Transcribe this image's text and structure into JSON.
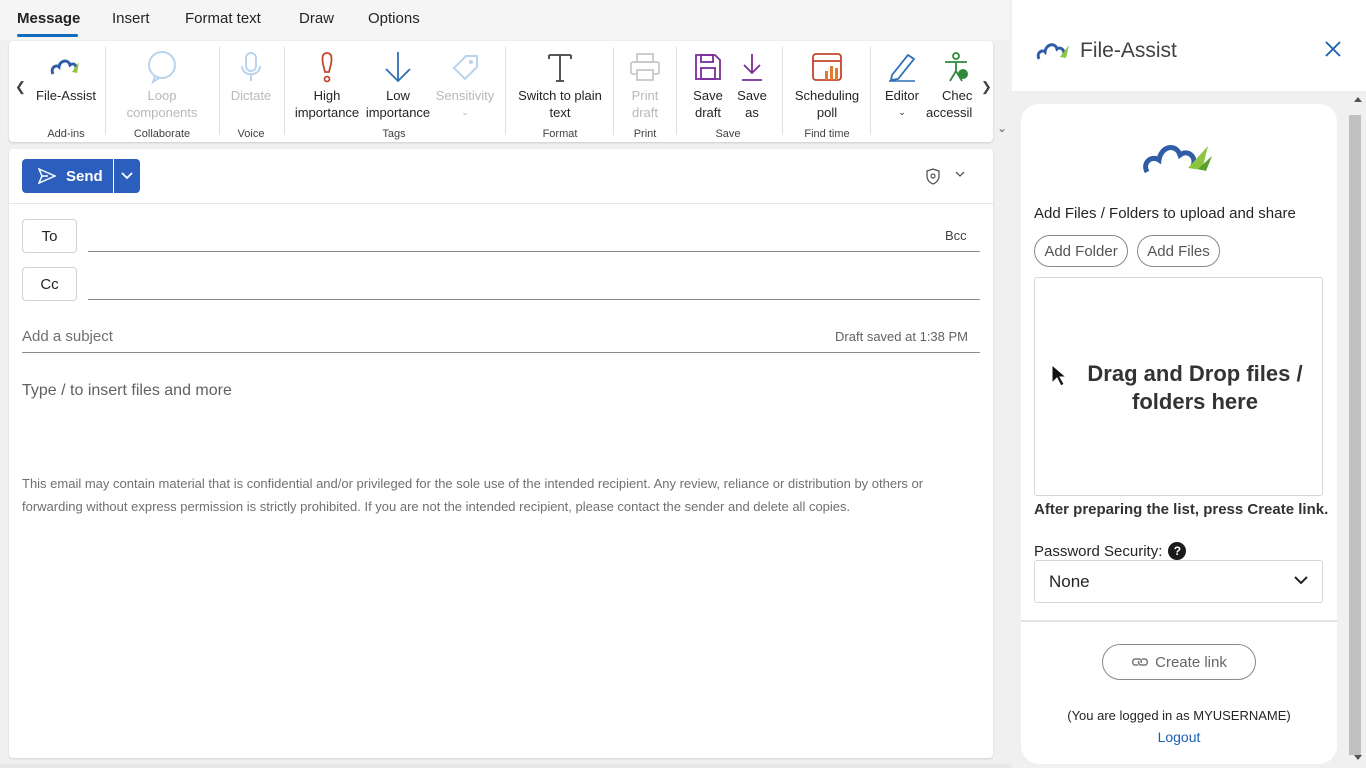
{
  "tabs": [
    {
      "label": "Message"
    },
    {
      "label": "Insert"
    },
    {
      "label": "Format text"
    },
    {
      "label": "Draw"
    },
    {
      "label": "Options"
    }
  ],
  "ribbon": {
    "file_assist": "File-Assist",
    "loop_1": "Loop",
    "loop_2": "components",
    "dictate": "Dictate",
    "high_1": "High",
    "high_2": "importance",
    "low_1": "Low",
    "low_2": "importance",
    "sensitivity": "Sensitivity",
    "switch_1": "Switch to plain",
    "switch_2": "text",
    "print_1": "Print",
    "print_2": "draft",
    "save_draft_1": "Save",
    "save_draft_2": "draft",
    "save_as_1": "Save",
    "save_as_2": "as",
    "poll_1": "Scheduling",
    "poll_2": "poll",
    "editor": "Editor",
    "check_1": "Chec",
    "check_2": "accessil",
    "groups": {
      "addins": "Add-ins",
      "collaborate": "Collaborate",
      "voice": "Voice",
      "tags": "Tags",
      "format": "Format",
      "print": "Print",
      "save": "Save",
      "findtime": "Find time"
    }
  },
  "compose": {
    "send_label": "Send",
    "to_label": "To",
    "cc_label": "Cc",
    "bcc_label": "Bcc",
    "subject_placeholder": "Add a subject",
    "draft_status": "Draft saved at 1:38 PM",
    "body_placeholder": "Type / to insert files and more",
    "disclaimer": "This email may contain material that is confidential and/or privileged for the sole use of the intended recipient. Any review, reliance or distribution by others or forwarding without express permission is strictly prohibited. If you are not the intended recipient, please contact the sender and delete all copies."
  },
  "panel": {
    "title": "File-Assist",
    "add_title": "Add Files / Folders to upload and share",
    "add_folder": "Add Folder",
    "add_files": "Add Files",
    "drop_text": "Drag and Drop files / folders here",
    "after_text": "After preparing the list, press Create link.",
    "password_label": "Password Security:",
    "password_value": "None",
    "create_link": "Create link",
    "logged_in": "(You are logged in as MYUSERNAME)",
    "logout": "Logout"
  },
  "colors": {
    "accent": "#0f6cbd",
    "send": "#2c5fbd",
    "link": "#1a5fb4",
    "logo_blue": "#2f5da8",
    "logo_green": "#8cc63f"
  },
  "icons": [
    "chevron-left-icon",
    "chevron-right-icon",
    "file-assist-logo-icon",
    "loop-icon",
    "mic-icon",
    "exclamation-icon",
    "arrow-down-icon",
    "tag-icon",
    "text-t-icon",
    "printer-icon",
    "floppy-icon",
    "download-icon",
    "calendar-poll-icon",
    "editor-pen-icon",
    "accessibility-icon",
    "send-icon",
    "shield-icon",
    "close-icon",
    "cursor-icon",
    "link-icon",
    "help-icon",
    "chevron-down-icon"
  ]
}
